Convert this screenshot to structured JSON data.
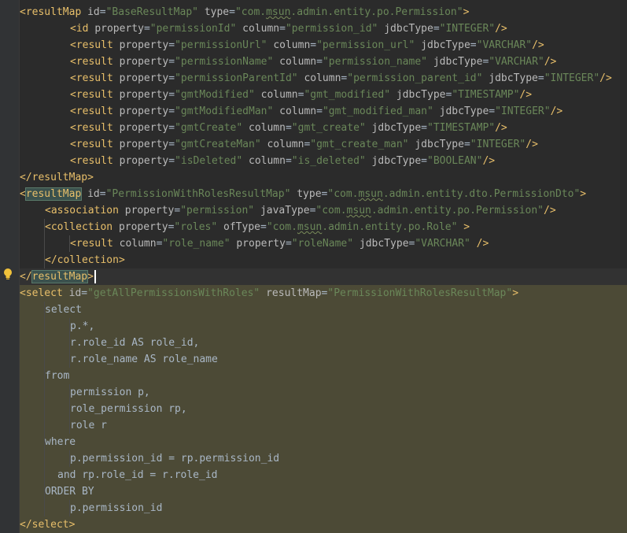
{
  "lines": [
    {
      "indent": 0,
      "tokens": [
        [
          "pun",
          "<"
        ],
        [
          "tag",
          "resultMap"
        ],
        [
          "txt",
          " "
        ],
        [
          "attr",
          "id"
        ],
        [
          "txt",
          "="
        ],
        [
          "val",
          "\"BaseResultMap\""
        ],
        [
          "txt",
          " "
        ],
        [
          "attr",
          "type"
        ],
        [
          "txt",
          "="
        ],
        [
          "val",
          "\"com."
        ],
        [
          "valw",
          "msun"
        ],
        [
          "val",
          ".admin.entity.po.Permission\""
        ],
        [
          "pun",
          ">"
        ]
      ]
    },
    {
      "indent": 2,
      "tokens": [
        [
          "pun",
          "<"
        ],
        [
          "tag",
          "id"
        ],
        [
          "txt",
          " "
        ],
        [
          "attr",
          "property"
        ],
        [
          "txt",
          "="
        ],
        [
          "val",
          "\"permissionId\""
        ],
        [
          "txt",
          " "
        ],
        [
          "attr",
          "column"
        ],
        [
          "txt",
          "="
        ],
        [
          "val",
          "\"permission_id\""
        ],
        [
          "txt",
          " "
        ],
        [
          "attr",
          "jdbcType"
        ],
        [
          "txt",
          "="
        ],
        [
          "val",
          "\"INTEGER\""
        ],
        [
          "pun",
          "/>"
        ]
      ]
    },
    {
      "indent": 2,
      "tokens": [
        [
          "pun",
          "<"
        ],
        [
          "tag",
          "result"
        ],
        [
          "txt",
          " "
        ],
        [
          "attr",
          "property"
        ],
        [
          "txt",
          "="
        ],
        [
          "val",
          "\"permissionUrl\""
        ],
        [
          "txt",
          " "
        ],
        [
          "attr",
          "column"
        ],
        [
          "txt",
          "="
        ],
        [
          "val",
          "\"permission_url\""
        ],
        [
          "txt",
          " "
        ],
        [
          "attr",
          "jdbcType"
        ],
        [
          "txt",
          "="
        ],
        [
          "val",
          "\"VARCHAR\""
        ],
        [
          "pun",
          "/>"
        ]
      ]
    },
    {
      "indent": 2,
      "tokens": [
        [
          "pun",
          "<"
        ],
        [
          "tag",
          "result"
        ],
        [
          "txt",
          " "
        ],
        [
          "attr",
          "property"
        ],
        [
          "txt",
          "="
        ],
        [
          "val",
          "\"permissionName\""
        ],
        [
          "txt",
          " "
        ],
        [
          "attr",
          "column"
        ],
        [
          "txt",
          "="
        ],
        [
          "val",
          "\"permission_name\""
        ],
        [
          "txt",
          " "
        ],
        [
          "attr",
          "jdbcType"
        ],
        [
          "txt",
          "="
        ],
        [
          "val",
          "\"VARCHAR\""
        ],
        [
          "pun",
          "/>"
        ]
      ]
    },
    {
      "indent": 2,
      "tokens": [
        [
          "pun",
          "<"
        ],
        [
          "tag",
          "result"
        ],
        [
          "txt",
          " "
        ],
        [
          "attr",
          "property"
        ],
        [
          "txt",
          "="
        ],
        [
          "val",
          "\"permissionParentId\""
        ],
        [
          "txt",
          " "
        ],
        [
          "attr",
          "column"
        ],
        [
          "txt",
          "="
        ],
        [
          "val",
          "\"permission_parent_id\""
        ],
        [
          "txt",
          " "
        ],
        [
          "attr",
          "jdbcType"
        ],
        [
          "txt",
          "="
        ],
        [
          "val",
          "\"INTEGER\""
        ],
        [
          "pun",
          "/>"
        ]
      ]
    },
    {
      "indent": 2,
      "tokens": [
        [
          "pun",
          "<"
        ],
        [
          "tag",
          "result"
        ],
        [
          "txt",
          " "
        ],
        [
          "attr",
          "property"
        ],
        [
          "txt",
          "="
        ],
        [
          "val",
          "\"gmtModified\""
        ],
        [
          "txt",
          " "
        ],
        [
          "attr",
          "column"
        ],
        [
          "txt",
          "="
        ],
        [
          "val",
          "\"gmt_modified\""
        ],
        [
          "txt",
          " "
        ],
        [
          "attr",
          "jdbcType"
        ],
        [
          "txt",
          "="
        ],
        [
          "val",
          "\"TIMESTAMP\""
        ],
        [
          "pun",
          "/>"
        ]
      ]
    },
    {
      "indent": 2,
      "tokens": [
        [
          "pun",
          "<"
        ],
        [
          "tag",
          "result"
        ],
        [
          "txt",
          " "
        ],
        [
          "attr",
          "property"
        ],
        [
          "txt",
          "="
        ],
        [
          "val",
          "\"gmtModifiedMan\""
        ],
        [
          "txt",
          " "
        ],
        [
          "attr",
          "column"
        ],
        [
          "txt",
          "="
        ],
        [
          "val",
          "\"gmt_modified_man\""
        ],
        [
          "txt",
          " "
        ],
        [
          "attr",
          "jdbcType"
        ],
        [
          "txt",
          "="
        ],
        [
          "val",
          "\"INTEGER\""
        ],
        [
          "pun",
          "/>"
        ]
      ]
    },
    {
      "indent": 2,
      "tokens": [
        [
          "pun",
          "<"
        ],
        [
          "tag",
          "result"
        ],
        [
          "txt",
          " "
        ],
        [
          "attr",
          "property"
        ],
        [
          "txt",
          "="
        ],
        [
          "val",
          "\"gmtCreate\""
        ],
        [
          "txt",
          " "
        ],
        [
          "attr",
          "column"
        ],
        [
          "txt",
          "="
        ],
        [
          "val",
          "\"gmt_create\""
        ],
        [
          "txt",
          " "
        ],
        [
          "attr",
          "jdbcType"
        ],
        [
          "txt",
          "="
        ],
        [
          "val",
          "\"TIMESTAMP\""
        ],
        [
          "pun",
          "/>"
        ]
      ]
    },
    {
      "indent": 2,
      "tokens": [
        [
          "pun",
          "<"
        ],
        [
          "tag",
          "result"
        ],
        [
          "txt",
          " "
        ],
        [
          "attr",
          "property"
        ],
        [
          "txt",
          "="
        ],
        [
          "val",
          "\"gmtCreateMan\""
        ],
        [
          "txt",
          " "
        ],
        [
          "attr",
          "column"
        ],
        [
          "txt",
          "="
        ],
        [
          "val",
          "\"gmt_create_man\""
        ],
        [
          "txt",
          " "
        ],
        [
          "attr",
          "jdbcType"
        ],
        [
          "txt",
          "="
        ],
        [
          "val",
          "\"INTEGER\""
        ],
        [
          "pun",
          "/>"
        ]
      ]
    },
    {
      "indent": 2,
      "tokens": [
        [
          "pun",
          "<"
        ],
        [
          "tag",
          "result"
        ],
        [
          "txt",
          " "
        ],
        [
          "attr",
          "property"
        ],
        [
          "txt",
          "="
        ],
        [
          "val",
          "\"isDeleted\""
        ],
        [
          "txt",
          " "
        ],
        [
          "attr",
          "column"
        ],
        [
          "txt",
          "="
        ],
        [
          "val",
          "\"is_deleted\""
        ],
        [
          "txt",
          " "
        ],
        [
          "attr",
          "jdbcType"
        ],
        [
          "txt",
          "="
        ],
        [
          "val",
          "\"BOOLEAN\""
        ],
        [
          "pun",
          "/>"
        ]
      ]
    },
    {
      "indent": 0,
      "tokens": [
        [
          "pun",
          "</"
        ],
        [
          "tag",
          "resultMap"
        ],
        [
          "pun",
          ">"
        ]
      ]
    },
    {
      "indent": 0,
      "tokens": [
        [
          "pun",
          "<"
        ],
        [
          "taghl",
          "resultMap"
        ],
        [
          "txt",
          " "
        ],
        [
          "attr",
          "id"
        ],
        [
          "txt",
          "="
        ],
        [
          "val",
          "\"PermissionWithRolesResultMap\""
        ],
        [
          "txt",
          " "
        ],
        [
          "attr",
          "type"
        ],
        [
          "txt",
          "="
        ],
        [
          "val",
          "\"com."
        ],
        [
          "valw",
          "msun"
        ],
        [
          "val",
          ".admin.entity.dto.PermissionDto\""
        ],
        [
          "pun",
          ">"
        ]
      ]
    },
    {
      "indent": 1,
      "tokens": [
        [
          "pun",
          "<"
        ],
        [
          "tag",
          "association"
        ],
        [
          "txt",
          " "
        ],
        [
          "attr",
          "property"
        ],
        [
          "txt",
          "="
        ],
        [
          "val",
          "\"permission\""
        ],
        [
          "txt",
          " "
        ],
        [
          "attr",
          "javaType"
        ],
        [
          "txt",
          "="
        ],
        [
          "val",
          "\"com."
        ],
        [
          "valw",
          "msun"
        ],
        [
          "val",
          ".admin.entity.po.Permission\""
        ],
        [
          "pun",
          "/>"
        ]
      ]
    },
    {
      "indent": 1,
      "tokens": [
        [
          "pun",
          "<"
        ],
        [
          "tag",
          "collection"
        ],
        [
          "txt",
          " "
        ],
        [
          "attr",
          "property"
        ],
        [
          "txt",
          "="
        ],
        [
          "val",
          "\"roles\""
        ],
        [
          "txt",
          " "
        ],
        [
          "attr",
          "ofType"
        ],
        [
          "txt",
          "="
        ],
        [
          "val",
          "\"com."
        ],
        [
          "valw",
          "msun"
        ],
        [
          "val",
          ".admin.entity.po.Role\""
        ],
        [
          "txt",
          " "
        ],
        [
          "pun",
          ">"
        ]
      ]
    },
    {
      "indent": 2,
      "tokens": [
        [
          "pun",
          "<"
        ],
        [
          "tag",
          "result"
        ],
        [
          "txt",
          " "
        ],
        [
          "attr",
          "column"
        ],
        [
          "txt",
          "="
        ],
        [
          "val",
          "\"role_name\""
        ],
        [
          "txt",
          " "
        ],
        [
          "attr",
          "property"
        ],
        [
          "txt",
          "="
        ],
        [
          "val",
          "\"roleName\""
        ],
        [
          "txt",
          " "
        ],
        [
          "attr",
          "jdbcType"
        ],
        [
          "txt",
          "="
        ],
        [
          "val",
          "\"VARCHAR\""
        ],
        [
          "txt",
          " "
        ],
        [
          "pun",
          "/>"
        ]
      ]
    },
    {
      "indent": 1,
      "tokens": [
        [
          "pun",
          "</"
        ],
        [
          "tag",
          "collection"
        ],
        [
          "pun",
          ">"
        ]
      ]
    },
    {
      "indent": 0,
      "caret": true,
      "tokens": [
        [
          "pun",
          "</"
        ],
        [
          "taghl",
          "resultMap"
        ],
        [
          "pun",
          ">"
        ]
      ]
    },
    {
      "indent": 0,
      "sql": true,
      "tokens": [
        [
          "pun",
          "<"
        ],
        [
          "tag",
          "select"
        ],
        [
          "txt",
          " "
        ],
        [
          "attr",
          "id"
        ],
        [
          "txt",
          "="
        ],
        [
          "val",
          "\"getAllPermissionsWithRoles\""
        ],
        [
          "txt",
          " "
        ],
        [
          "attr",
          "resultMap"
        ],
        [
          "txt",
          "="
        ],
        [
          "val",
          "\"PermissionWithRolesResultMap\""
        ],
        [
          "pun",
          ">"
        ]
      ]
    },
    {
      "indent": 1,
      "sql": true,
      "tokens": [
        [
          "txt",
          "select"
        ]
      ]
    },
    {
      "indent": 2,
      "sql": true,
      "tokens": [
        [
          "txt",
          "p.*,"
        ]
      ]
    },
    {
      "indent": 2,
      "sql": true,
      "tokens": [
        [
          "txt",
          "r.role_id AS role_id,"
        ]
      ]
    },
    {
      "indent": 2,
      "sql": true,
      "tokens": [
        [
          "txt",
          "r.role_name AS role_name"
        ]
      ]
    },
    {
      "indent": 1,
      "sql": true,
      "tokens": [
        [
          "txt",
          "from"
        ]
      ]
    },
    {
      "indent": 2,
      "sql": true,
      "tokens": [
        [
          "txt",
          "permission p,"
        ]
      ]
    },
    {
      "indent": 2,
      "sql": true,
      "tokens": [
        [
          "txt",
          "role_permission rp,"
        ]
      ]
    },
    {
      "indent": 2,
      "sql": true,
      "tokens": [
        [
          "txt",
          "role r"
        ]
      ]
    },
    {
      "indent": 1,
      "sql": true,
      "tokens": [
        [
          "txt",
          "where"
        ]
      ]
    },
    {
      "indent": 2,
      "sql": true,
      "tokens": [
        [
          "txt",
          "p.permission_id = rp.permission_id"
        ]
      ]
    },
    {
      "indent": 1,
      "sql": true,
      "extra": "  ",
      "tokens": [
        [
          "txt",
          "and rp.role_id = r.role_id"
        ]
      ]
    },
    {
      "indent": 1,
      "sql": true,
      "tokens": [
        [
          "txt",
          "ORDER BY"
        ]
      ]
    },
    {
      "indent": 2,
      "sql": true,
      "tokens": [
        [
          "txt",
          "p.permission_id"
        ]
      ]
    },
    {
      "indent": 0,
      "sql": true,
      "tokens": [
        [
          "pun",
          "</"
        ],
        [
          "tag",
          "select"
        ],
        [
          "pun",
          ">"
        ]
      ]
    }
  ],
  "colors": {
    "background": "#2b2b2b",
    "tag": "#e8bf6a",
    "attribute": "#bababa",
    "value": "#6a8759",
    "text": "#a9b7c6",
    "sql_highlight": "#4c4a36"
  },
  "gutter_icons": [
    "lightbulb-icon"
  ]
}
